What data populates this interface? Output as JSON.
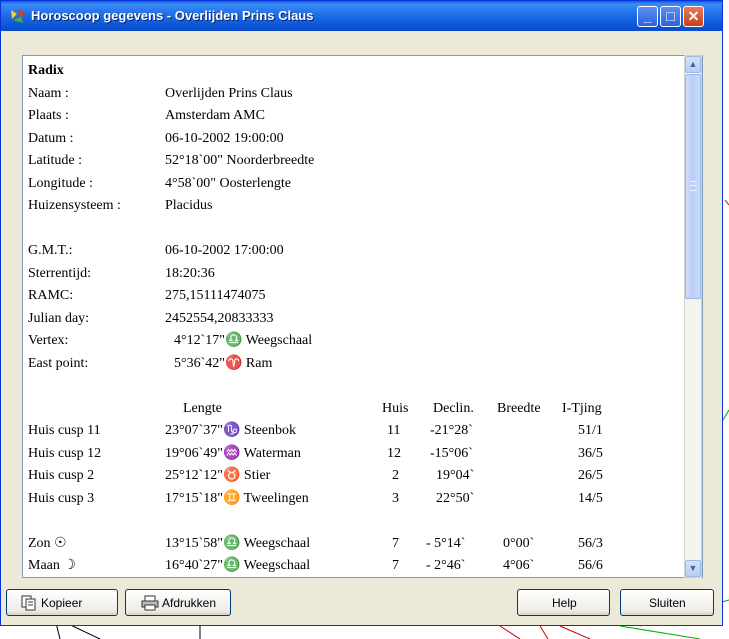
{
  "window": {
    "title": "Horoscoop gegevens - Overlijden Prins Claus",
    "controls": {
      "minimize": "_",
      "maximize": "□",
      "close": "✕"
    },
    "icon": "horoscope-app-icon"
  },
  "radix_heading": "Radix",
  "info_rows": [
    {
      "label": "Naam :",
      "value": "Overlijden Prins Claus"
    },
    {
      "label": "Plaats :",
      "value": "Amsterdam AMC"
    },
    {
      "label": "Datum :",
      "value": "06-10-2002 19:00:00"
    },
    {
      "label": "Latitude :",
      "value": "52°18`00\" Noorderbreedte"
    },
    {
      "label": "Longitude :",
      "value": "4°58`00\" Oosterlengte"
    },
    {
      "label": "Huizensysteem :",
      "value": "Placidus"
    }
  ],
  "time_rows": [
    {
      "label": "G.M.T.:",
      "value": "06-10-2002 17:00:00"
    },
    {
      "label": "Sterrentijd:",
      "value": "18:20:36"
    },
    {
      "label": "RAMC:",
      "value": "275,15111474075"
    },
    {
      "label": "Julian day:",
      "value": "2452554,20833333"
    },
    {
      "label": "Vertex:",
      "value": "4°12`17\"♎ Weegschaal"
    },
    {
      "label": "East point:",
      "value": "5°36`42\"♈ Ram"
    }
  ],
  "table_headers": {
    "lengte": "Lengte",
    "huis": "Huis",
    "declin": "Declin.",
    "breedte": "Breedte",
    "itjing": "I-Tjing"
  },
  "cusp_rows": [
    {
      "label": "Huis cusp 11",
      "lengte": "23°07`37\"♑ Steenbok",
      "huis": "11",
      "declin": "-21°28`",
      "breedte": "",
      "itjing": "51/1"
    },
    {
      "label": "Huis cusp 12",
      "lengte": "19°06`49\"♒ Waterman",
      "huis": "12",
      "declin": "-15°06`",
      "breedte": "",
      "itjing": "36/5"
    },
    {
      "label": "Huis cusp 2",
      "lengte": "25°12`12\"♉ Stier",
      "huis": "2",
      "declin": "19°04`",
      "breedte": "",
      "itjing": "26/5"
    },
    {
      "label": "Huis cusp 3",
      "lengte": "17°15`18\"♊ Tweelingen",
      "huis": "3",
      "declin": "22°50`",
      "breedte": "",
      "itjing": "14/5"
    }
  ],
  "planet_rows": [
    {
      "label": "Zon ☉",
      "lengte": "13°15`58\"♎ Weegschaal",
      "huis": "7",
      "declin": "- 5°14`",
      "breedte": "0°00`",
      "itjing": "56/3"
    },
    {
      "label": "Maan ☽",
      "lengte": "16°40`27\"♎ Weegschaal",
      "huis": "7",
      "declin": "- 2°46`",
      "breedte": "4°06`",
      "itjing": "56/6"
    }
  ],
  "buttons": {
    "copy": {
      "label": "Kopieer",
      "icon": "copy-icon"
    },
    "print": {
      "label": "Afdrukken",
      "icon": "printer-icon"
    },
    "help": {
      "label": "Help"
    },
    "close": {
      "label": "Sluiten"
    }
  },
  "scrollbar": {
    "up": "▲",
    "down": "▼"
  }
}
